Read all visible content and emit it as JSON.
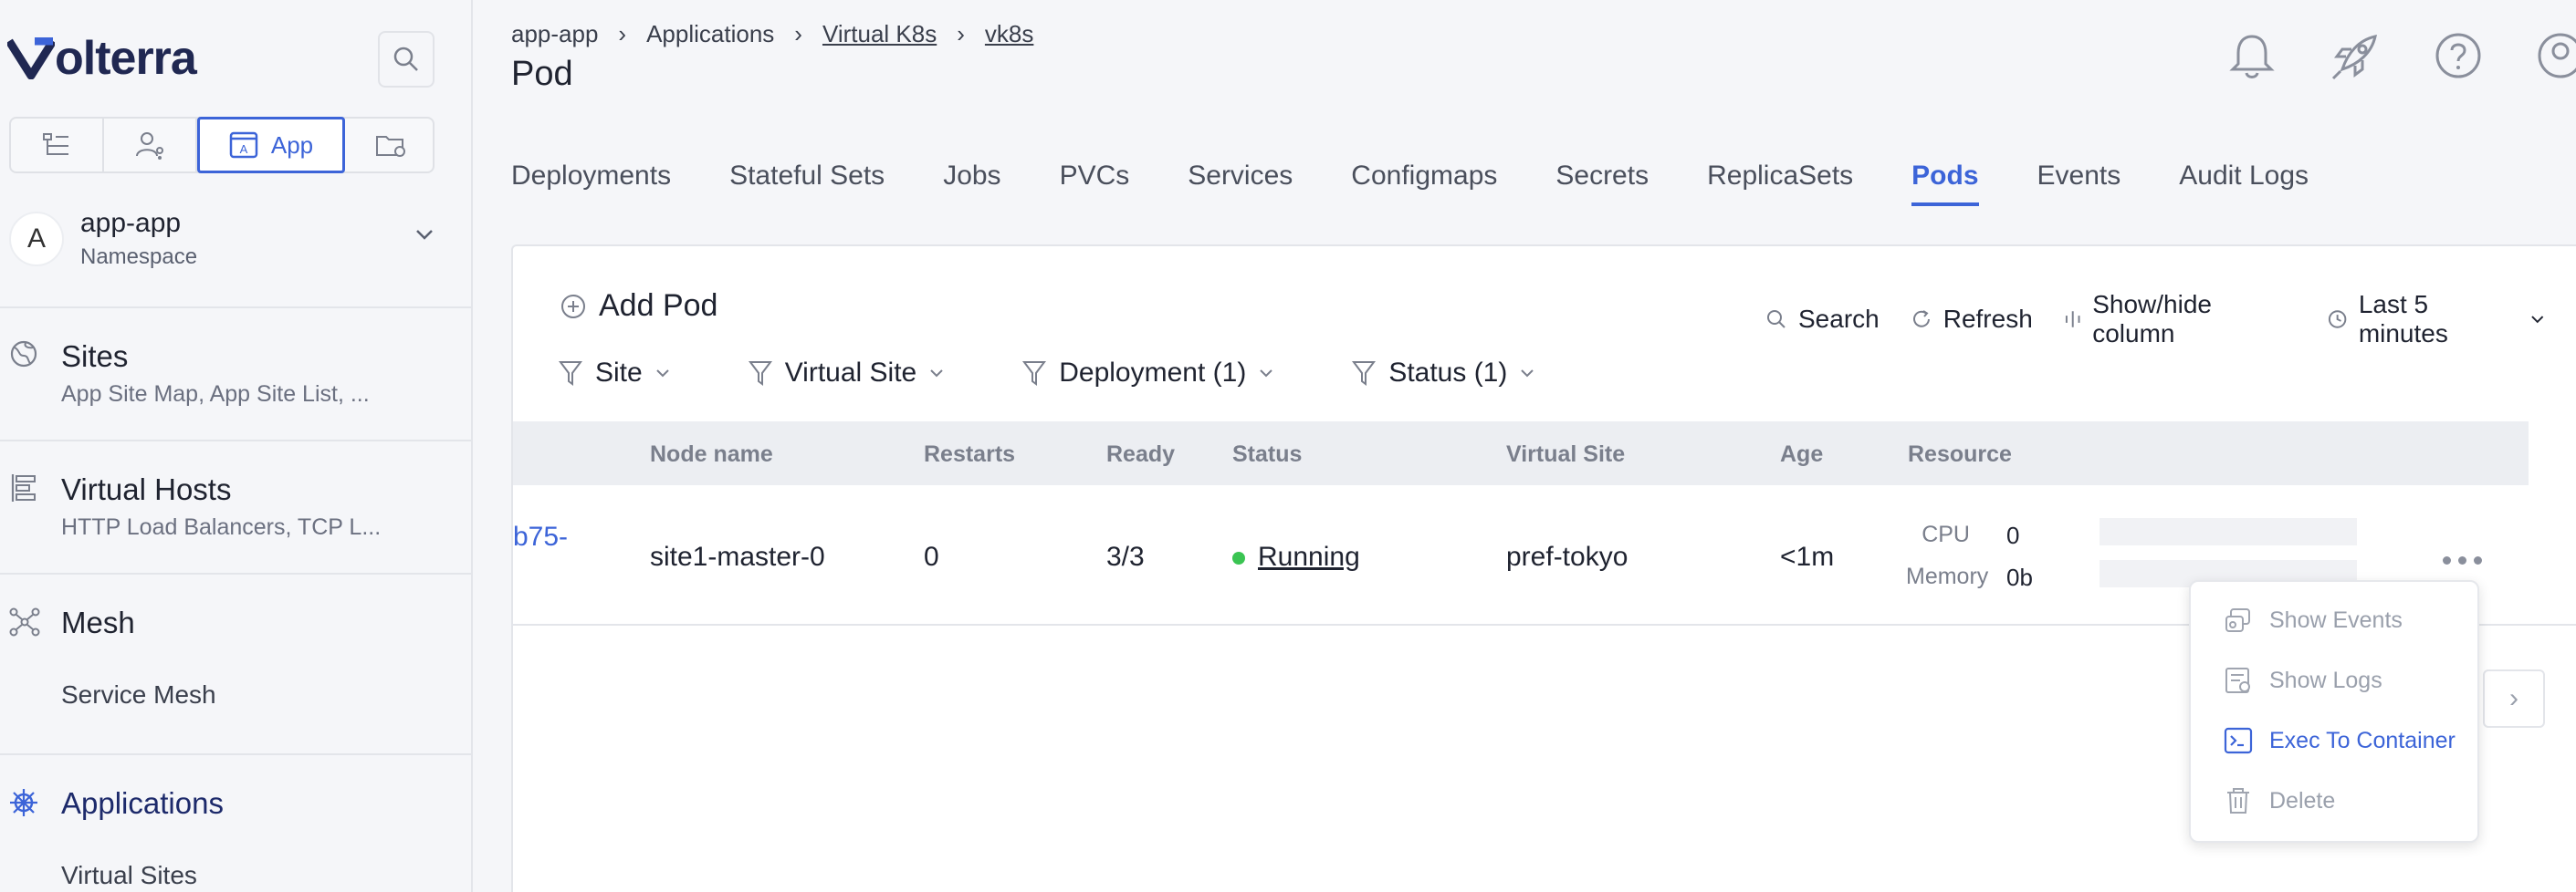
{
  "brand": {
    "name": "olterra"
  },
  "sidebar": {
    "modes": [
      {
        "icon": "hierarchy-icon"
      },
      {
        "icon": "user-share-icon"
      },
      {
        "label": "App",
        "icon": "app-icon",
        "active": true
      },
      {
        "icon": "folder-gear-icon"
      }
    ],
    "namespace": {
      "initial": "A",
      "name": "app-app",
      "type": "Namespace"
    },
    "sections": [
      {
        "title": "Sites",
        "sub": "App Site Map, App Site List, ..."
      },
      {
        "title": "Virtual Hosts",
        "sub": "HTTP Load Balancers, TCP L..."
      },
      {
        "title": "Mesh",
        "sub": "Service Mesh"
      },
      {
        "title": "Applications",
        "sub": "Virtual Sites"
      }
    ]
  },
  "breadcrumb": [
    "app-app",
    "Applications",
    "Virtual K8s",
    "vk8s"
  ],
  "page_title": "Pod",
  "tabs": [
    "Deployments",
    "Stateful Sets",
    "Jobs",
    "PVCs",
    "Services",
    "Configmaps",
    "Secrets",
    "ReplicaSets",
    "Pods",
    "Events",
    "Audit Logs"
  ],
  "active_tab": "Pods",
  "toolbar": {
    "add_label": "Add Pod",
    "search": "Search",
    "refresh": "Refresh",
    "columns": "Show/hide column",
    "time": "Last 5 minutes"
  },
  "filters": [
    "Site",
    "Virtual Site",
    "Deployment (1)",
    "Status (1)"
  ],
  "table": {
    "headers": [
      "Node name",
      "Restarts",
      "Ready",
      "Status",
      "Virtual Site",
      "Age",
      "Resource"
    ],
    "row": {
      "name_fragment": "b75-",
      "node": "site1-master-0",
      "restarts": "0",
      "ready": "3/3",
      "status": "Running",
      "virtual_site": "pref-tokyo",
      "age": "<1m",
      "cpu_label": "CPU",
      "cpu_value": "0",
      "memory_label": "Memory",
      "memory_value": "0b"
    }
  },
  "menu": [
    {
      "label": "Show Events",
      "icon": "events-icon",
      "enabled": false
    },
    {
      "label": "Show Logs",
      "icon": "logs-icon",
      "enabled": false
    },
    {
      "label": "Exec To Container",
      "icon": "terminal-icon",
      "enabled": true
    },
    {
      "label": "Delete",
      "icon": "trash-icon",
      "enabled": false
    }
  ],
  "pager": {
    "next": "›"
  },
  "colors": {
    "accent": "#3c64d8",
    "running": "#3ac452",
    "brand": "#202852"
  }
}
